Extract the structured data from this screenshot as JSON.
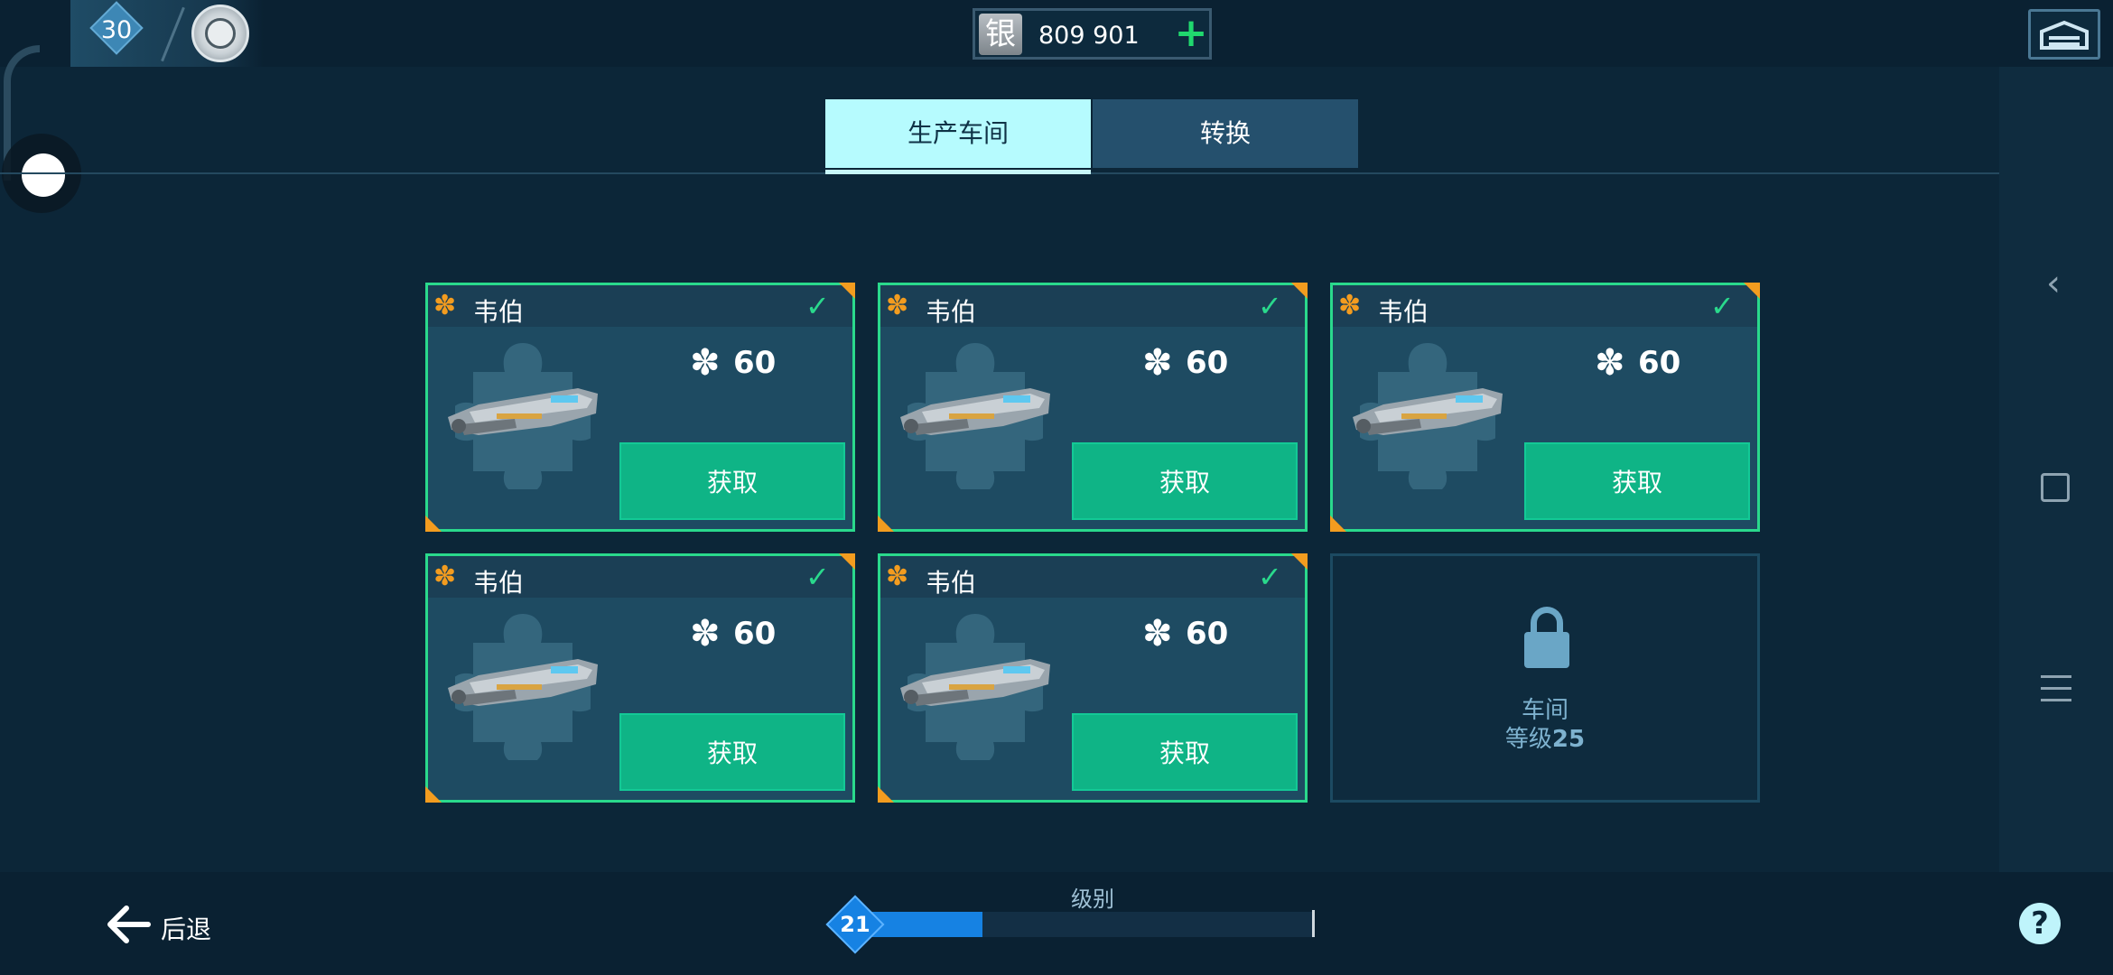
{
  "header": {
    "player_level": "30",
    "currency_icon_char": "银",
    "currency_amount": "809 901",
    "add_currency_symbol": "+"
  },
  "tabs": [
    {
      "label": "生产车间",
      "active": true
    },
    {
      "label": "转换",
      "active": false
    }
  ],
  "cards": [
    {
      "name": "韦伯",
      "cost": "60",
      "button": "获取",
      "checked": true
    },
    {
      "name": "韦伯",
      "cost": "60",
      "button": "获取",
      "checked": true
    },
    {
      "name": "韦伯",
      "cost": "60",
      "button": "获取",
      "checked": true
    },
    {
      "name": "韦伯",
      "cost": "60",
      "button": "获取",
      "checked": true
    },
    {
      "name": "韦伯",
      "cost": "60",
      "button": "获取",
      "checked": true
    }
  ],
  "locked_slot": {
    "line1": "车间",
    "line2_prefix": "等级",
    "line2_level": "25"
  },
  "footer": {
    "back_label": "后退",
    "level_label": "级别",
    "level_value": "21",
    "level_progress": 0.28,
    "help_symbol": "?"
  },
  "colors": {
    "accent_green": "#2ad98c",
    "button_green": "#0fb486",
    "active_tab": "#b6fbfe",
    "progress_blue": "#1682e3",
    "badge_orange": "#f39c1f"
  }
}
